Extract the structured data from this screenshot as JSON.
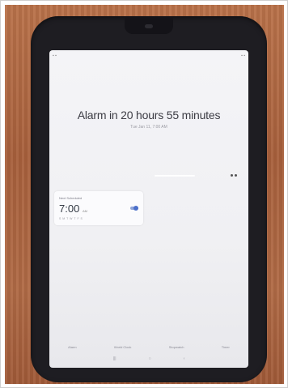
{
  "alarm": {
    "title": "Alarm in 20 hours 55 minutes",
    "subtitle": "Tue Jan 11, 7:00 AM"
  },
  "card": {
    "label": "Next Scheduled",
    "time": "7:00",
    "ampm": "AM",
    "days": "S M T W T F S",
    "enabled": true
  },
  "tabs": [
    "Alarm",
    "World Clock",
    "Stopwatch",
    "Timer"
  ],
  "nav": {
    "recent_glyph": "|||",
    "home_glyph": "○",
    "back_glyph": "‹"
  },
  "colors": {
    "wall": "#a8603c",
    "case": "#1e1d22",
    "screen": "#f2f2f5",
    "toggle": "#4b6fc9"
  }
}
